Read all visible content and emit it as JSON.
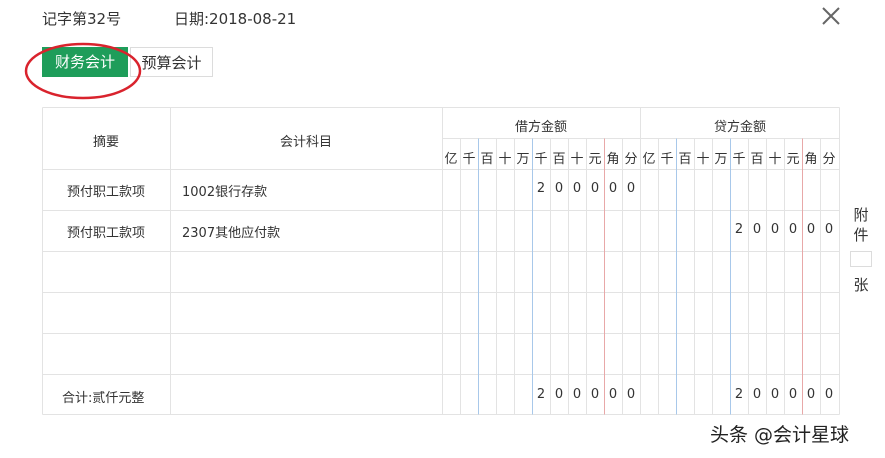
{
  "header": {
    "voucher_no": "记字第32号",
    "date": "日期:2018-08-21"
  },
  "tabs": [
    {
      "label": "财务会计",
      "active": true
    },
    {
      "label": "预算会计",
      "active": false
    }
  ],
  "table": {
    "headers": {
      "summary": "摘要",
      "account": "会计科目",
      "debit": "借方金额",
      "credit": "贷方金额",
      "units": [
        "亿",
        "千",
        "百",
        "十",
        "万",
        "千",
        "百",
        "十",
        "元",
        "角",
        "分"
      ]
    },
    "rows": [
      {
        "summary": "预付职工款项",
        "account": "1002银行存款",
        "debit": [
          "",
          "",
          "",
          "",
          "",
          "2",
          "0",
          "0",
          "0",
          "0",
          "0"
        ],
        "credit": [
          "",
          "",
          "",
          "",
          "",
          "",
          "",
          "",
          "",
          "",
          ""
        ]
      },
      {
        "summary": "预付职工款项",
        "account": "2307其他应付款",
        "debit": [
          "",
          "",
          "",
          "",
          "",
          "",
          "",
          "",
          "",
          "",
          ""
        ],
        "credit": [
          "",
          "",
          "",
          "",
          "",
          "2",
          "0",
          "0",
          "0",
          "0",
          "0"
        ]
      },
      {
        "summary": "",
        "account": "",
        "debit": [
          "",
          "",
          "",
          "",
          "",
          "",
          "",
          "",
          "",
          "",
          ""
        ],
        "credit": [
          "",
          "",
          "",
          "",
          "",
          "",
          "",
          "",
          "",
          "",
          ""
        ]
      },
      {
        "summary": "",
        "account": "",
        "debit": [
          "",
          "",
          "",
          "",
          "",
          "",
          "",
          "",
          "",
          "",
          ""
        ],
        "credit": [
          "",
          "",
          "",
          "",
          "",
          "",
          "",
          "",
          "",
          "",
          ""
        ]
      },
      {
        "summary": "",
        "account": "",
        "debit": [
          "",
          "",
          "",
          "",
          "",
          "",
          "",
          "",
          "",
          "",
          ""
        ],
        "credit": [
          "",
          "",
          "",
          "",
          "",
          "",
          "",
          "",
          "",
          "",
          ""
        ]
      }
    ],
    "total": {
      "label": "合计:贰仟元整",
      "debit": [
        "",
        "",
        "",
        "",
        "",
        "2",
        "0",
        "0",
        "0",
        "0",
        "0"
      ],
      "credit": [
        "",
        "",
        "",
        "",
        "",
        "2",
        "0",
        "0",
        "0",
        "0",
        "0"
      ]
    }
  },
  "attachment": {
    "chars": [
      "附",
      "件"
    ],
    "unit": "张",
    "count": ""
  },
  "watermark": "头条 @会计星球",
  "colors": {
    "active_tab": "#1e9d5a",
    "annotation": "#d9232d",
    "grid": "#e3e3e3",
    "thousands_divider": "#a8c8ea",
    "yuan_divider": "#e8a8a8"
  },
  "icons": {
    "close": "close-icon"
  }
}
